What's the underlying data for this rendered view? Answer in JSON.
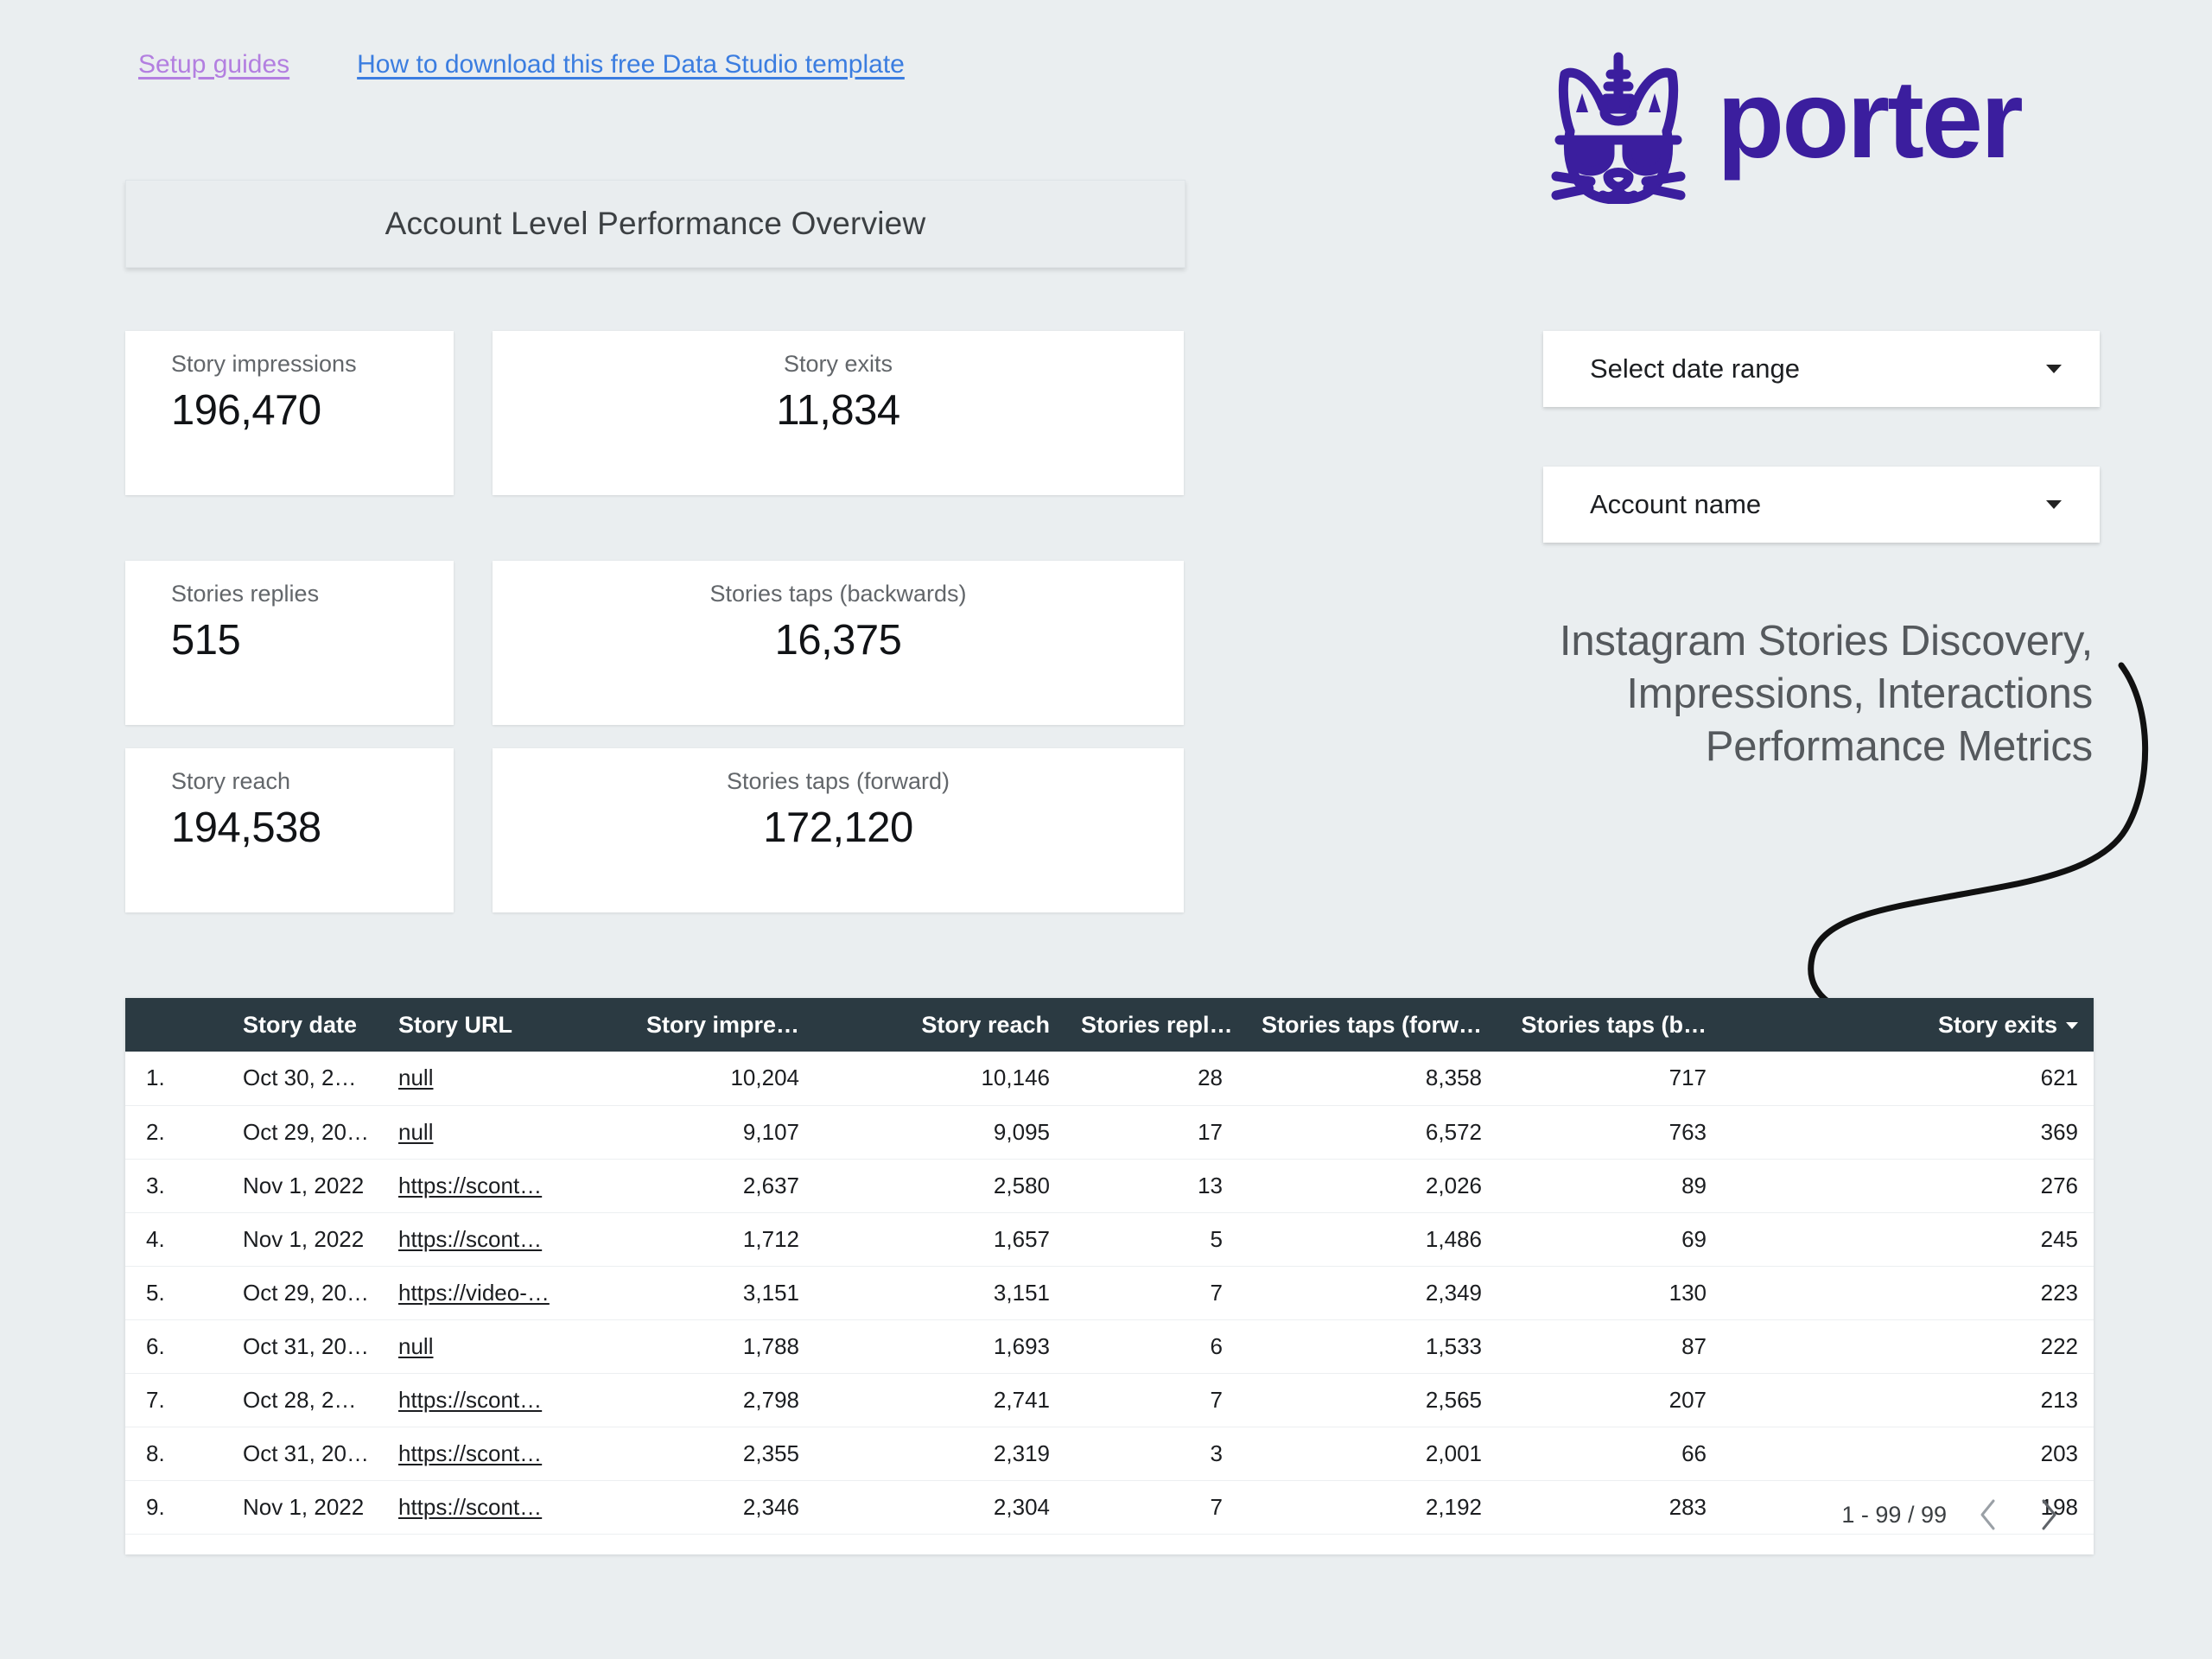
{
  "top_links": [
    {
      "label": "Setup guides",
      "style": "purple"
    },
    {
      "label": "How to download this free Data Studio template",
      "style": "blue"
    }
  ],
  "brand": {
    "name": "porter",
    "color": "#3b1e9e",
    "logo_icon": "unicorn-cat-logo"
  },
  "section": {
    "title": "Account Level Performance Overview"
  },
  "scorecards": [
    {
      "label": "Story impressions",
      "value": "196,470"
    },
    {
      "label": "Story exits",
      "value": "11,834"
    },
    {
      "label": "Stories replies",
      "value": "515"
    },
    {
      "label": "Stories taps (backwards)",
      "value": "16,375"
    },
    {
      "label": "Story reach",
      "value": "194,538"
    },
    {
      "label": "Stories taps (forward)",
      "value": "172,120"
    }
  ],
  "filters": [
    {
      "label": "Select date range",
      "icon": "chevron-down-icon"
    },
    {
      "label": "Account name",
      "icon": "chevron-down-icon"
    }
  ],
  "headline": {
    "line1": "Instagram Stories Discovery,",
    "line2": "Impressions, Interactions",
    "line3": "Performance Metrics"
  },
  "table": {
    "columns": [
      {
        "key": "idx",
        "label": "",
        "align": "left"
      },
      {
        "key": "date",
        "label": "Story date",
        "align": "left"
      },
      {
        "key": "url",
        "label": "Story URL",
        "align": "left"
      },
      {
        "key": "impressions",
        "label": "Story impre…",
        "align": "right"
      },
      {
        "key": "reach",
        "label": "Story reach",
        "align": "right"
      },
      {
        "key": "replies",
        "label": "Stories repl…",
        "align": "right"
      },
      {
        "key": "taps_forward",
        "label": "Stories taps (forw…",
        "align": "right"
      },
      {
        "key": "taps_backward",
        "label": "Stories taps (b…",
        "align": "right"
      },
      {
        "key": "exits",
        "label": "Story exits",
        "align": "right",
        "sorted": true
      }
    ],
    "rows": [
      {
        "idx": "1.",
        "date": "Oct 30, 2…",
        "url": "null",
        "impressions": "10,204",
        "reach": "10,146",
        "replies": "28",
        "taps_forward": "8,358",
        "taps_backward": "717",
        "exits": "621"
      },
      {
        "idx": "2.",
        "date": "Oct 29, 20…",
        "url": "null",
        "impressions": "9,107",
        "reach": "9,095",
        "replies": "17",
        "taps_forward": "6,572",
        "taps_backward": "763",
        "exits": "369"
      },
      {
        "idx": "3.",
        "date": "Nov 1, 2022",
        "url": "https://scont…",
        "impressions": "2,637",
        "reach": "2,580",
        "replies": "13",
        "taps_forward": "2,026",
        "taps_backward": "89",
        "exits": "276"
      },
      {
        "idx": "4.",
        "date": "Nov 1, 2022",
        "url": "https://scont…",
        "impressions": "1,712",
        "reach": "1,657",
        "replies": "5",
        "taps_forward": "1,486",
        "taps_backward": "69",
        "exits": "245"
      },
      {
        "idx": "5.",
        "date": "Oct 29, 20…",
        "url": "https://video-…",
        "impressions": "3,151",
        "reach": "3,151",
        "replies": "7",
        "taps_forward": "2,349",
        "taps_backward": "130",
        "exits": "223"
      },
      {
        "idx": "6.",
        "date": "Oct 31, 20…",
        "url": "null",
        "impressions": "1,788",
        "reach": "1,693",
        "replies": "6",
        "taps_forward": "1,533",
        "taps_backward": "87",
        "exits": "222"
      },
      {
        "idx": "7.",
        "date": "Oct 28, 2…",
        "url": "https://scont…",
        "impressions": "2,798",
        "reach": "2,741",
        "replies": "7",
        "taps_forward": "2,565",
        "taps_backward": "207",
        "exits": "213"
      },
      {
        "idx": "8.",
        "date": "Oct 31, 20…",
        "url": "https://scont…",
        "impressions": "2,355",
        "reach": "2,319",
        "replies": "3",
        "taps_forward": "2,001",
        "taps_backward": "66",
        "exits": "203"
      },
      {
        "idx": "9.",
        "date": "Nov 1, 2022",
        "url": "https://scont…",
        "impressions": "2,346",
        "reach": "2,304",
        "replies": "7",
        "taps_forward": "2,192",
        "taps_backward": "283",
        "exits": "198"
      }
    ],
    "pagination": {
      "range": "1 - 99 / 99",
      "prev_icon": "chevron-left-icon",
      "next_icon": "chevron-right-icon"
    }
  }
}
